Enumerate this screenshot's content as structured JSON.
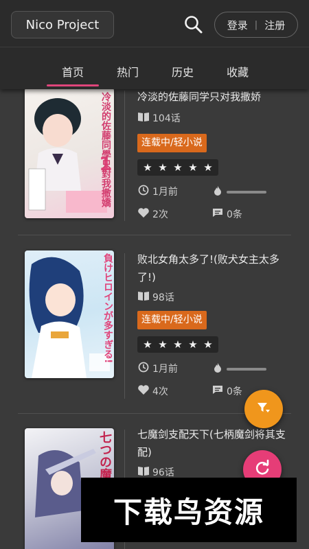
{
  "header": {
    "brand": "Nico Project",
    "login": "登录",
    "separator": "|",
    "register": "注册"
  },
  "tabs": [
    {
      "label": "首页",
      "active": true
    },
    {
      "label": "热门",
      "active": false
    },
    {
      "label": "历史",
      "active": false
    },
    {
      "label": "收藏",
      "active": false
    }
  ],
  "items": [
    {
      "title": "冷淡的佐藤同学只对我撒娇",
      "chapters": "104话",
      "tag": "连载中/轻小说",
      "stars": [
        "★",
        "★",
        "★",
        "★",
        "★"
      ],
      "updated": "1月前",
      "likes": "2次",
      "comments": "0条",
      "cover_text": "冷淡的佐藤同學只對我撒嬌"
    },
    {
      "title": "败北女角太多了!(败犬女主太多了!)",
      "chapters": "98话",
      "tag": "连载中/轻小说",
      "stars": [
        "★",
        "★",
        "★",
        "★",
        "★"
      ],
      "updated": "1月前",
      "likes": "4次",
      "comments": "0条",
      "cover_text": "負けヒロインが多すぎる!"
    },
    {
      "title": "七魔剑支配天下(七柄魔剑将其支配)",
      "chapters": "96话",
      "cover_text": "七つの魔剣"
    }
  ],
  "watermark": "下载鸟资源",
  "colors": {
    "accent_pink": "#e0457b",
    "tag_orange": "#d9691c",
    "fab_orange": "#f0961c",
    "fab_pink": "#e63d77"
  }
}
